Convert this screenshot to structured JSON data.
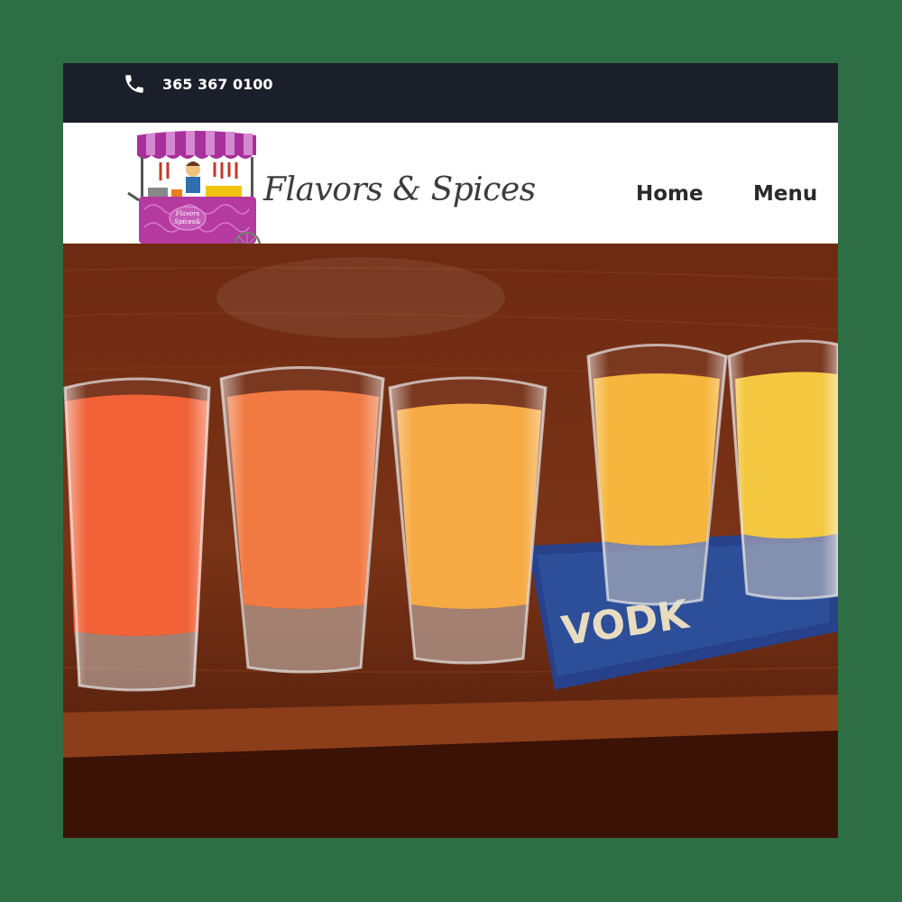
{
  "topbar": {
    "phone": "365 367 0100",
    "phone_icon": "phone-icon"
  },
  "header": {
    "brand": "Flavors & Spices",
    "logo_badge": "Flavors Spices &",
    "nav": [
      {
        "label": "Home"
      },
      {
        "label": "Menu"
      }
    ]
  },
  "hero": {
    "glass_word": "VODK"
  },
  "colors": {
    "page_bg": "#2e6e45",
    "topbar_bg": "#1b1f2a",
    "nav_bg": "#ffffff",
    "logo_accent": "#b43aa0"
  }
}
